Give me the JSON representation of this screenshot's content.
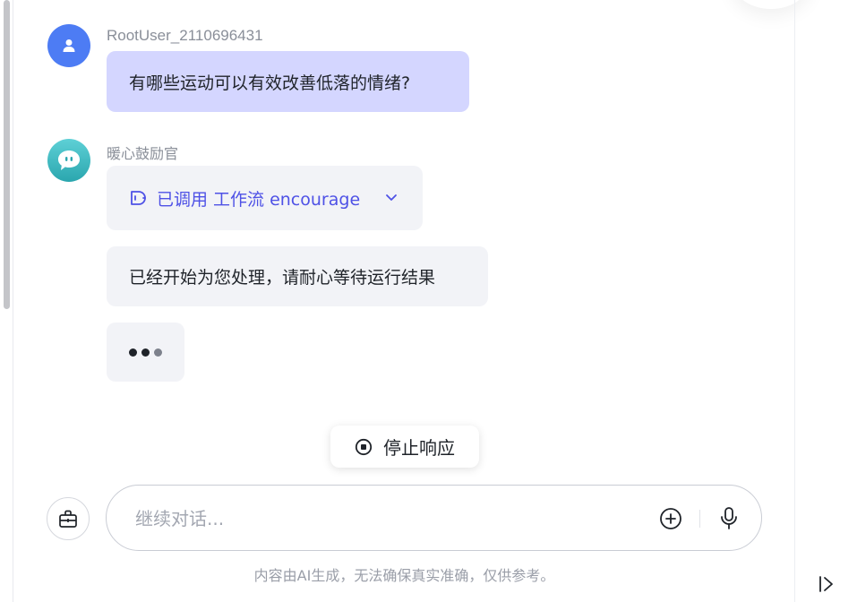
{
  "conversation": {
    "user": {
      "name": "RootUser_2110696431",
      "avatar_icon": "user-icon",
      "avatar_color": "#4d7cf4",
      "message": "有哪些运动可以有效改善低落的情绪?"
    },
    "bot": {
      "name": "暖心鼓励官",
      "avatar_icon": "chat-bubble-icon",
      "tool_call_label": "已调用 工作流 encourage",
      "tool_icon": "plugin-icon",
      "expand_icon": "chevron-down-icon",
      "message": "已经开始为您处理，请耐心等待运行结果",
      "loading_indicator": "typing-dots"
    }
  },
  "stop_button": {
    "label": "停止响应",
    "icon": "stop-circle-icon"
  },
  "composer": {
    "tools_icon": "toolbox-icon",
    "placeholder": "继续对话...",
    "add_icon": "plus-circle-icon",
    "mic_icon": "microphone-icon"
  },
  "disclaimer": "内容由AI生成，无法确保真实准确，仅供参考。",
  "sidebar_toggle_icon": "expand-panel-icon",
  "colors": {
    "accent": "#4e51e6",
    "user_bubble": "#d4d6ff",
    "bot_bubble": "#f2f3f7"
  }
}
